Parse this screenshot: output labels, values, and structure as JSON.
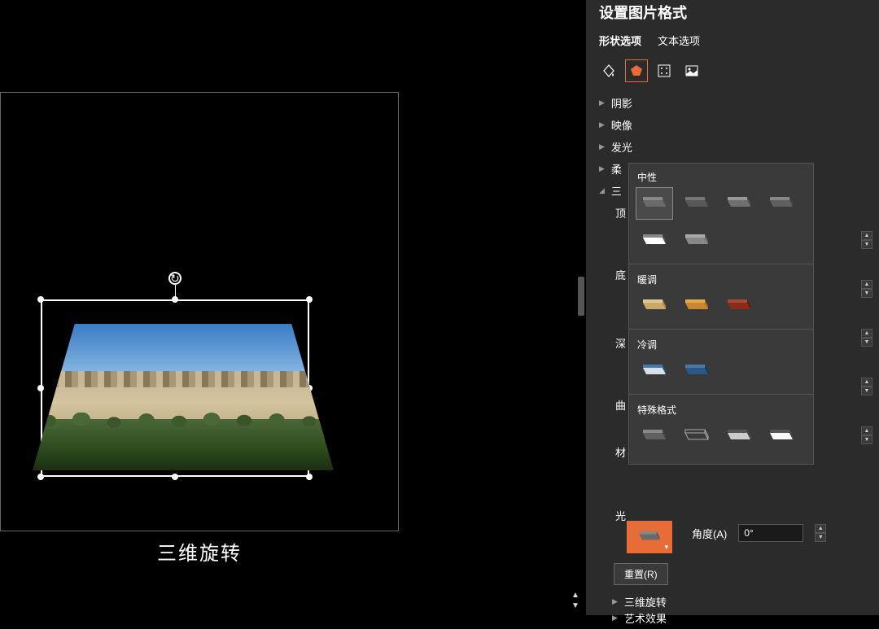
{
  "canvas": {
    "caption": "三维旋转"
  },
  "panel": {
    "title": "设置图片格式",
    "tabs": {
      "shape": "形状选项",
      "text": "文本选项"
    },
    "icons": [
      "fill-icon",
      "effects-icon",
      "size-icon",
      "picture-icon"
    ],
    "sections": {
      "shadow": "阴影",
      "reflection": "映像",
      "glow": "发光",
      "soft": "柔",
      "three_d": "三",
      "rotation": "三维旋转",
      "artistic": "艺术效果"
    },
    "truncated": {
      "top": "顶",
      "bottom": "底",
      "depth": "深",
      "contour": "曲",
      "material": "材"
    },
    "lighting": "光",
    "angle_label": "角度(A)",
    "angle_value": "0°",
    "reset": "重置(R)"
  },
  "material_popup": {
    "groups": {
      "neutral": "中性",
      "warm": "暖调",
      "cool": "冷调",
      "special": "特殊格式"
    }
  }
}
